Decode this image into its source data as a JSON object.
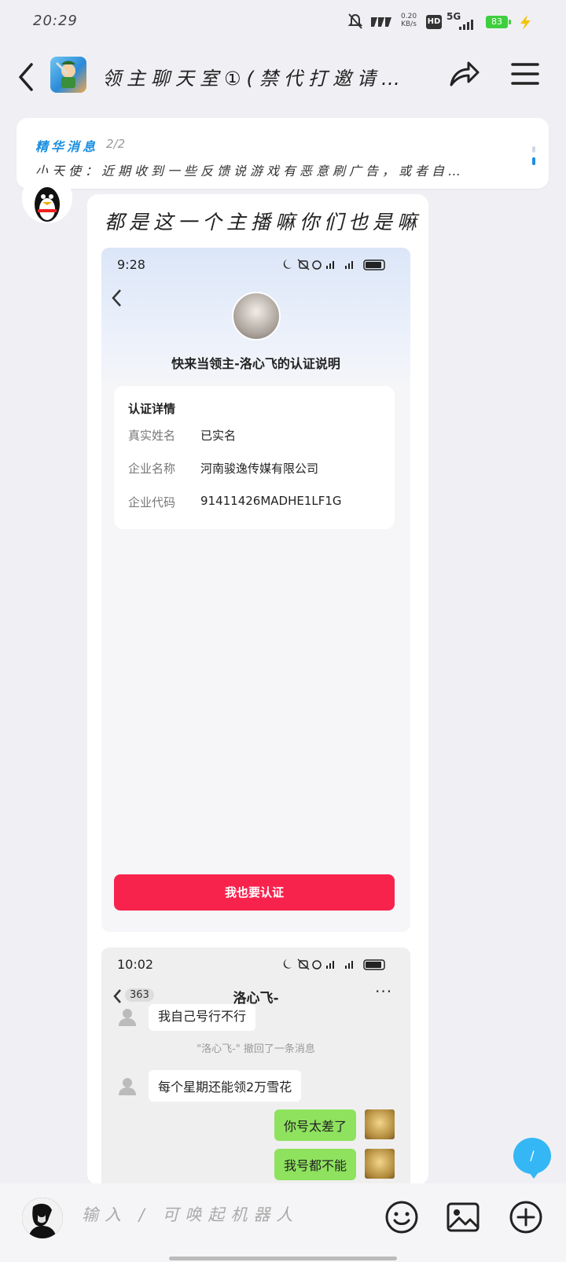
{
  "status_bar": {
    "time": "20:29",
    "net_speed": "0.20\nKB/s",
    "hd": "HD",
    "network": "5G",
    "battery": "83"
  },
  "header": {
    "title": "领主聊天室①(禁代打邀请…"
  },
  "pinned": {
    "label": "精华消息",
    "count": "2/2",
    "text": "小天使：近期收到一些反馈说游戏有恶意刷广告，或者自…"
  },
  "message": {
    "text": "都是这一个主播嘛你们也是嘛",
    "screenshot1": {
      "time": "9:28",
      "title": "快来当领主-洛心飞的认证说明",
      "card_title": "认证详情",
      "rows": [
        {
          "label": "真实姓名",
          "value": "已实名"
        },
        {
          "label": "企业名称",
          "value": "河南骏逸传媒有限公司"
        },
        {
          "label": "企业代码",
          "value": "91411426MADHE1LF1G"
        }
      ],
      "button": "我也要认证"
    },
    "screenshot2": {
      "time": "10:02",
      "back_count": "363",
      "name": "洛心飞-",
      "more": "···",
      "messages": [
        {
          "side": "left",
          "text": "我自己号行不行"
        },
        {
          "side": "system",
          "text": "\"洛心飞-\" 撤回了一条消息"
        },
        {
          "side": "left",
          "text": "每个星期还能领2万雪花"
        },
        {
          "side": "right",
          "text": "你号太差了"
        },
        {
          "side": "right",
          "text": "我号都不能"
        }
      ]
    }
  },
  "floating_button": {
    "label": "/"
  },
  "input_bar": {
    "placeholder": "输入 / 可唤起机器人"
  },
  "colors": {
    "accent_blue": "#1a8fe0",
    "cta_red": "#f8234d",
    "chat_green": "#8ee25e",
    "float_blue": "#35b7f5"
  }
}
